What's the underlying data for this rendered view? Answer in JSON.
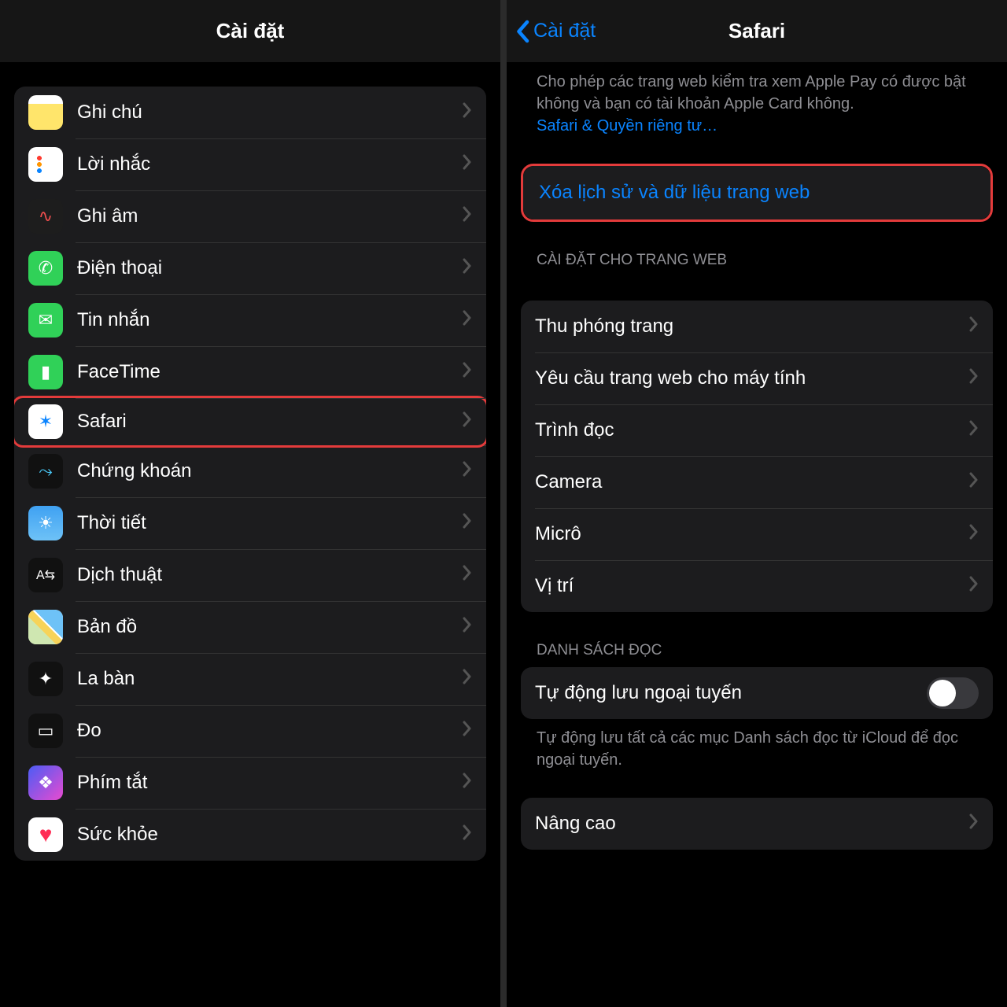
{
  "left": {
    "title": "Cài đặt",
    "rows": [
      {
        "id": "notes",
        "label": "Ghi chú",
        "iconClass": "i-notes",
        "iconName": "notes-app-icon"
      },
      {
        "id": "reminders",
        "label": "Lời nhắc",
        "iconClass": "i-reminders",
        "iconName": "reminders-app-icon"
      },
      {
        "id": "voice",
        "label": "Ghi âm",
        "iconClass": "i-voice",
        "iconName": "voice-memos-app-icon",
        "glyph": "∿"
      },
      {
        "id": "phone",
        "label": "Điện thoại",
        "iconClass": "i-phone",
        "iconName": "phone-app-icon",
        "glyph": "✆"
      },
      {
        "id": "messages",
        "label": "Tin nhắn",
        "iconClass": "i-messages",
        "iconName": "messages-app-icon",
        "glyph": "✉"
      },
      {
        "id": "facetime",
        "label": "FaceTime",
        "iconClass": "i-facetime",
        "iconName": "facetime-app-icon",
        "glyph": "▮"
      },
      {
        "id": "safari",
        "label": "Safari",
        "iconClass": "i-safari",
        "iconName": "safari-app-icon",
        "glyph": "✶",
        "highlighted": true
      },
      {
        "id": "stocks",
        "label": "Chứng khoán",
        "iconClass": "i-stocks",
        "iconName": "stocks-app-icon",
        "glyph": "⤳"
      },
      {
        "id": "weather",
        "label": "Thời tiết",
        "iconClass": "i-weather",
        "iconName": "weather-app-icon",
        "glyph": "☀"
      },
      {
        "id": "translate",
        "label": "Dịch thuật",
        "iconClass": "i-translate",
        "iconName": "translate-app-icon",
        "glyph": "A⇆"
      },
      {
        "id": "maps",
        "label": "Bản đồ",
        "iconClass": "i-maps",
        "iconName": "maps-app-icon"
      },
      {
        "id": "compass",
        "label": "La bàn",
        "iconClass": "i-compass",
        "iconName": "compass-app-icon",
        "glyph": "✦"
      },
      {
        "id": "measure",
        "label": "Đo",
        "iconClass": "i-measure",
        "iconName": "measure-app-icon",
        "glyph": "▭"
      },
      {
        "id": "shortcuts",
        "label": "Phím tắt",
        "iconClass": "i-shortcuts",
        "iconName": "shortcuts-app-icon",
        "glyph": "❖"
      },
      {
        "id": "health",
        "label": "Sức khỏe",
        "iconClass": "i-health",
        "iconName": "health-app-icon",
        "glyph": "♥"
      }
    ]
  },
  "right": {
    "back_label": "Cài đặt",
    "title": "Safari",
    "footnote_main": "Cho phép các trang web kiểm tra xem Apple Pay có được bật không và bạn có tài khoản Apple Card không.",
    "footnote_link": "Safari & Quyền riêng tư…",
    "clear_history_label": "Xóa lịch sử và dữ liệu trang web",
    "settings_header": "CÀI ĐẶT CHO TRANG WEB",
    "settings_rows": [
      {
        "id": "zoom",
        "label": "Thu phóng trang"
      },
      {
        "id": "desktop",
        "label": "Yêu cầu trang web cho máy tính"
      },
      {
        "id": "reader",
        "label": "Trình đọc"
      },
      {
        "id": "camera",
        "label": "Camera"
      },
      {
        "id": "microphone",
        "label": "Micrô"
      },
      {
        "id": "location",
        "label": "Vị trí"
      }
    ],
    "reading_list_header": "DANH SÁCH ĐỌC",
    "auto_save_label": "Tự động lưu ngoại tuyến",
    "auto_save_on": false,
    "reading_list_footer": "Tự động lưu tất cả các mục Danh sách đọc từ iCloud để đọc ngoại tuyến.",
    "advanced_label": "Nâng cao"
  }
}
